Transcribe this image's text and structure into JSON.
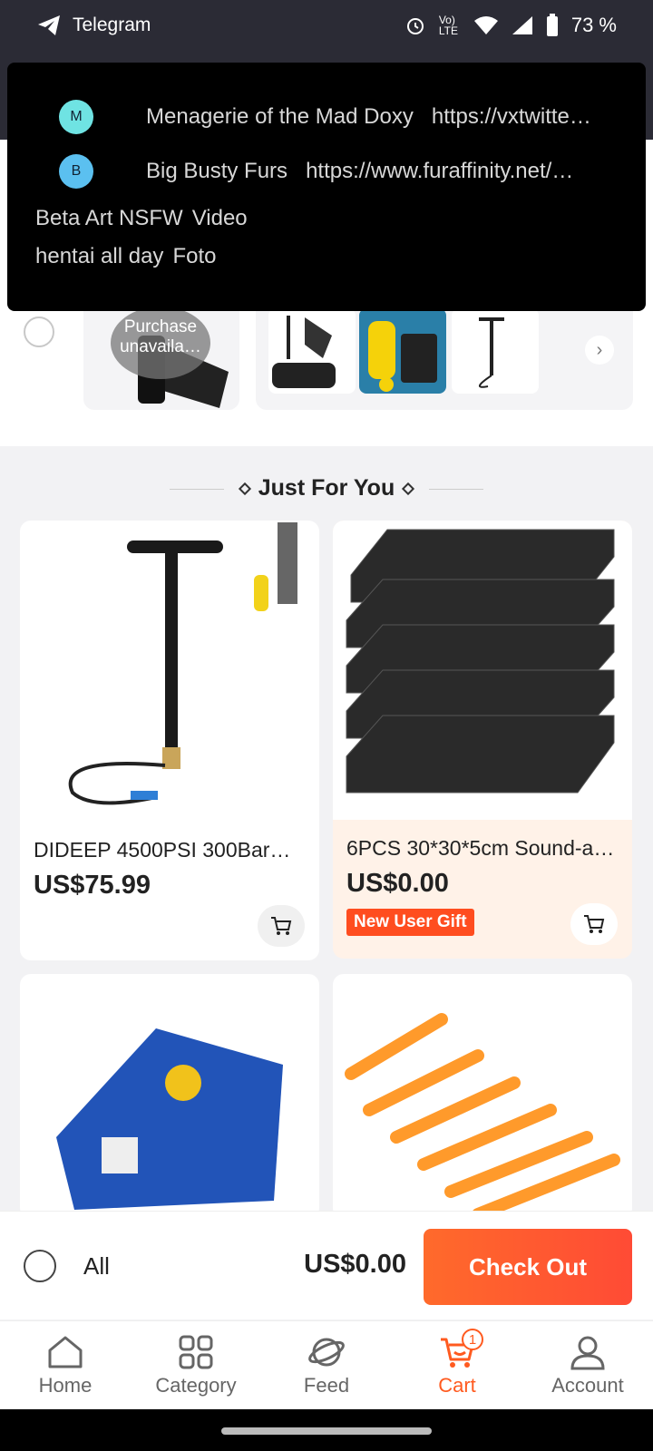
{
  "status_bar": {
    "app_name": "Telegram",
    "network": "Vo) LTE",
    "battery": "73 %"
  },
  "notification": {
    "chats": [
      {
        "initial": "M",
        "name": "Menagerie of the Mad Doxy",
        "preview": "https://vxtwitte…",
        "color": "#6fe3e3"
      },
      {
        "initial": "B",
        "name": "Big Busty Furs",
        "preview": "https://www.furaffinity.net/…",
        "color": "#5bc0f0"
      }
    ],
    "line3": [
      "Beta Art NSFW",
      "Video"
    ],
    "line4": [
      "hentai all day",
      "Foto"
    ]
  },
  "cart_strip": {
    "unavailable_label": "Purchase unavaila…"
  },
  "section": {
    "title": "Just For You"
  },
  "products": [
    {
      "title": "DIDEEP 4500PSI 300Bar…",
      "price": "US$75.99"
    },
    {
      "title": "6PCS 30*30*5cm Sound-a…",
      "price": "US$0.00",
      "badge": "New User Gift"
    }
  ],
  "checkout": {
    "all_label": "All",
    "total": "US$0.00",
    "button_label": "Check Out"
  },
  "tabs": [
    {
      "label": "Home",
      "icon": "home-icon"
    },
    {
      "label": "Category",
      "icon": "category-icon"
    },
    {
      "label": "Feed",
      "icon": "feed-icon"
    },
    {
      "label": "Cart",
      "icon": "cart-icon",
      "badge": "1",
      "active": true
    },
    {
      "label": "Account",
      "icon": "account-icon"
    }
  ],
  "colors": {
    "accent": "#ff5a1f",
    "status_bar": "#2b2b35"
  }
}
